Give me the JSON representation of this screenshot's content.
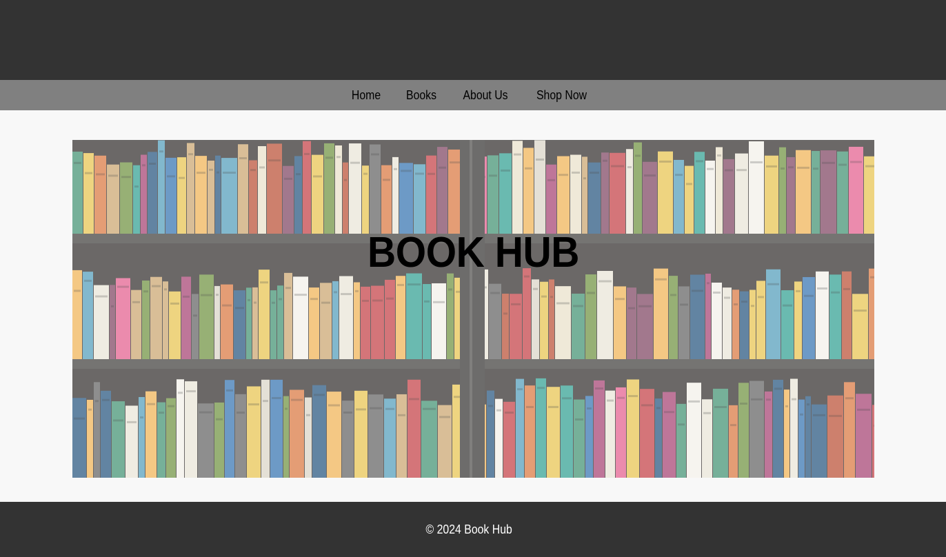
{
  "nav": {
    "items": [
      {
        "label": "Home"
      },
      {
        "label": "Books"
      },
      {
        "label": "About Us"
      },
      {
        "label": "Shop Now"
      }
    ]
  },
  "hero": {
    "title": "BOOK HUB"
  },
  "footer": {
    "text": "© 2024 Book Hub"
  },
  "colors": {
    "header_bg": "#333333",
    "nav_bg": "#808080",
    "page_bg": "#f8f8f8",
    "footer_bg": "#333333"
  }
}
